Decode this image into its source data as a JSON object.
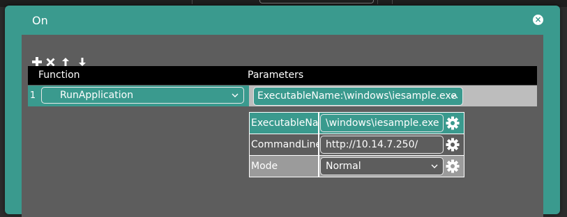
{
  "dialog": {
    "title": "On",
    "close_glyph": "×"
  },
  "toolbar": {
    "items": [
      {
        "name": "add-icon"
      },
      {
        "name": "delete-icon"
      },
      {
        "name": "move-up-icon"
      },
      {
        "name": "move-down-icon"
      }
    ]
  },
  "grid": {
    "columns": [
      "Function",
      "Parameters"
    ],
    "rows": [
      {
        "number": "1",
        "function": "RunApplication",
        "parameters": "ExecutableName:\\windows\\iesample.exe"
      }
    ]
  },
  "params_popup": {
    "rows": [
      {
        "label": "ExecutableName",
        "value": "\\windows\\iesample.exe",
        "kind": "text"
      },
      {
        "label": "CommandLine",
        "value": "http://10.14.7.250/",
        "kind": "text"
      },
      {
        "label": "Mode",
        "value": "Normal",
        "kind": "select"
      }
    ]
  },
  "colors": {
    "accent": "#3a9a8e",
    "panel": "#5d5d5d",
    "header": "#000000",
    "row_highlight": "#bdbdbd"
  }
}
